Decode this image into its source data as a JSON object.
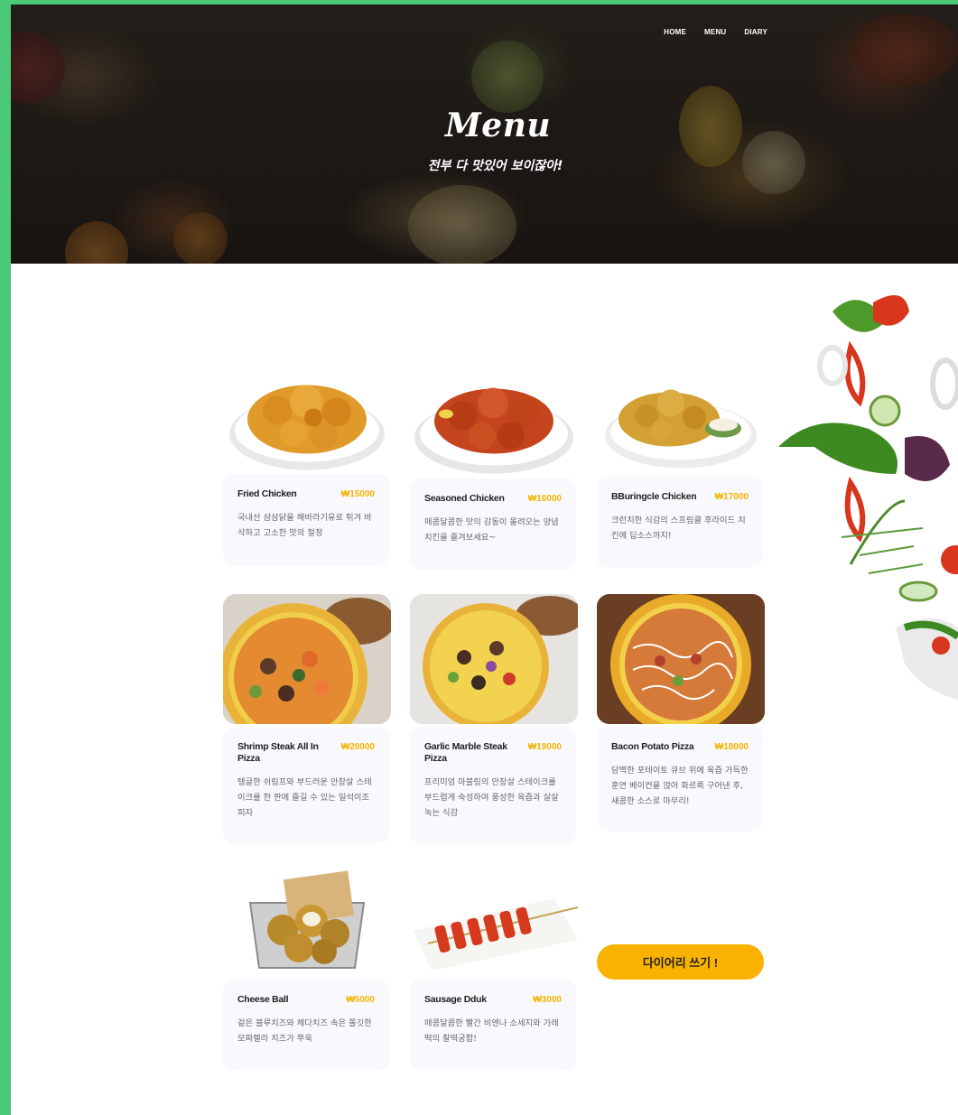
{
  "nav": {
    "home": "HOME",
    "menu": "MENU",
    "diary": "DIARY"
  },
  "hero": {
    "title": "Menu",
    "subtitle": "전부 다 맛있어 보이잖아!"
  },
  "menu_items": [
    {
      "name": "Fried Chicken",
      "price": "₩15000",
      "desc": "국내산 삼삼닭을 해바라기유로 튀겨 바삭하고 고소한 맛의 절정",
      "image": "fried-chicken"
    },
    {
      "name": "Seasoned Chicken",
      "price": "₩16000",
      "desc": "매콤달콤한 맛의 감동이 몰려오는 양념치킨을 즐겨보세요~",
      "image": "seasoned-chicken"
    },
    {
      "name": "BBuringcle Chicken",
      "price": "₩17000",
      "desc": "크런치한 식감의 스프림클 후라이드 치킨에 딥소스까지!",
      "image": "bburingcle-chicken"
    },
    {
      "name": "Shrimp Steak All In Pizza",
      "price": "₩20000",
      "desc": "탱글한 쉬림프와 부드러운 안창살 스테이크를 한 판에 즐길 수 있는 일석이조 피자",
      "image": "shrimp-pizza"
    },
    {
      "name": "Garlic Marble Steak Pizza",
      "price": "₩19000",
      "desc": "프리미엄 마블링의 안창살 스테이크를 부드럽게 숙성하여 풍성한 육즙과 살살 녹는 식감",
      "image": "garlic-pizza"
    },
    {
      "name": "Bacon Potato Pizza",
      "price": "₩18000",
      "desc": "담백한 포테이토 큐브 위에 육즙 가득한 훈연 베이컨을 얹어 화르륵 구어낸 후, 새콤한 소스로 마무리!",
      "image": "bacon-pizza"
    },
    {
      "name": "Cheese Ball",
      "price": "₩5000",
      "desc": "겉은 블루치즈와 체다치즈 속은 쫄깃한 모짜렐라 치즈가 쭈욱",
      "image": "cheese-ball"
    },
    {
      "name": "Sausage Dduk",
      "price": "₩3000",
      "desc": "매콤달콤한 빨간 비엔나 소세지와 가래떡의 찰떡궁합!",
      "image": "sausage-dduk"
    }
  ],
  "diary_button": "다이어리 쓰기 !",
  "colors": {
    "accent": "#f9b200",
    "price": "#f5b400",
    "frame": "#4cc879",
    "card_bg": "#f9f8fd"
  }
}
